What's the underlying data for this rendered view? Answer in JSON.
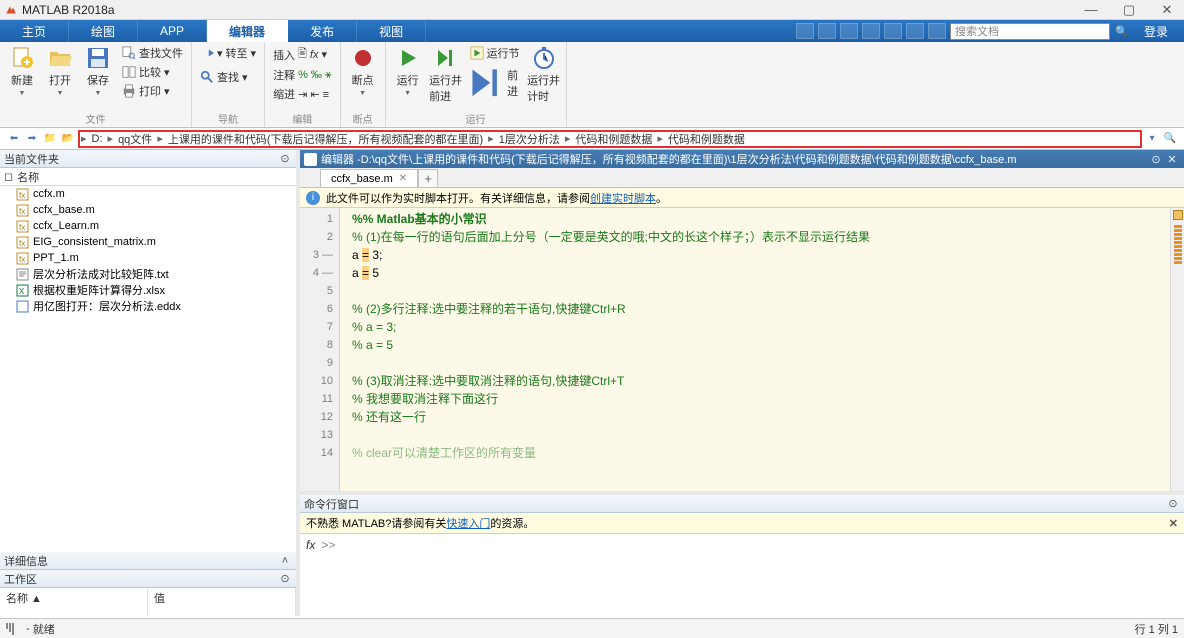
{
  "app_title": "MATLAB R2018a",
  "tabs": [
    "主页",
    "绘图",
    "APP",
    "编辑器",
    "发布",
    "视图"
  ],
  "active_tab_index": 3,
  "search_placeholder": "搜索文档",
  "login_label": "登录",
  "ribbon": {
    "groups": [
      {
        "name": "文件",
        "big": [
          {
            "key": "new",
            "label": "新建"
          },
          {
            "key": "open",
            "label": "打开"
          },
          {
            "key": "save",
            "label": "保存"
          }
        ],
        "small": [
          {
            "key": "findfiles",
            "label": "查找文件"
          },
          {
            "key": "compare",
            "label": "比较"
          },
          {
            "key": "print",
            "label": "打印"
          }
        ]
      },
      {
        "name": "导航",
        "big": [],
        "small": [
          {
            "key": "goto",
            "label": "转至"
          },
          {
            "key": "find",
            "label": "查找"
          }
        ]
      },
      {
        "name": "编辑",
        "big": [],
        "small": [
          {
            "key": "insert",
            "label": "插入"
          },
          {
            "key": "comment",
            "label": "注释"
          },
          {
            "key": "indent",
            "label": "缩进"
          }
        ]
      },
      {
        "name": "断点",
        "big": [
          {
            "key": "bp",
            "label": "断点"
          }
        ]
      },
      {
        "name": "运行",
        "big": [
          {
            "key": "run",
            "label": "运行"
          },
          {
            "key": "runadv",
            "label": "运行并\n前进"
          },
          {
            "key": "runsec",
            "label": "前进"
          },
          {
            "key": "runtime",
            "label": "运行并\n计时"
          }
        ],
        "small": [
          {
            "key": "runsection",
            "label": "运行节"
          }
        ]
      }
    ]
  },
  "path_segments": [
    "D:",
    "qq文件",
    "上课用的课件和代码(下载后记得解压，所有视频配套的都在里面)",
    "1层次分析法",
    "代码和例题数据",
    "代码和例题数据"
  ],
  "panels": {
    "current_folder": "当前文件夹",
    "name_col": "名称",
    "details": "详细信息",
    "workspace": "工作区",
    "ws_cols": [
      "名称 ▲",
      "值"
    ],
    "command_window": "命令行窗口"
  },
  "files": [
    {
      "name": "ccfx.m",
      "type": "m"
    },
    {
      "name": "ccfx_base.m",
      "type": "m"
    },
    {
      "name": "ccfx_Learn.m",
      "type": "m"
    },
    {
      "name": "EIG_consistent_matrix.m",
      "type": "m"
    },
    {
      "name": "PPT_1.m",
      "type": "m"
    },
    {
      "name": "层次分析法成对比较矩阵.txt",
      "type": "txt"
    },
    {
      "name": "根据权重矩阵计算得分.xlsx",
      "type": "xlsx"
    },
    {
      "name": "用亿图打开：层次分析法.eddx",
      "type": "eddx"
    }
  ],
  "editor": {
    "title_prefix": "编辑器 - ",
    "filepath": "D:\\qq文件\\上课用的课件和代码(下载后记得解压，所有视频配套的都在里面)\\1层次分析法\\代码和例题数据\\代码和例题数据\\ccfx_base.m",
    "tab": "ccfx_base.m",
    "info_pre": "此文件可以作为实时脚本打开。有关详细信息，请参阅 ",
    "info_link": "创建实时脚本",
    "info_post": "。",
    "lines": [
      {
        "n": "1",
        "cls": "c-sect",
        "raw": "%% Matlab基本的小常识"
      },
      {
        "n": "2",
        "cls": "c-comm",
        "raw": "% (1)在每一行的语句后面加上分号（一定要是英文的哦;中文的长这个样子；）表示不显示运行结果"
      },
      {
        "n": "3 —",
        "cls": "c-code",
        "raw": "a = 3;",
        "hl": "="
      },
      {
        "n": "4 —",
        "cls": "c-code",
        "raw": "a = 5",
        "hl": "="
      },
      {
        "n": "5",
        "cls": "",
        "raw": ""
      },
      {
        "n": "6",
        "cls": "c-comm",
        "raw": "% (2)多行注释:选中要注释的若干语句,快捷键Ctrl+R"
      },
      {
        "n": "7",
        "cls": "c-comm",
        "raw": "% a = 3;"
      },
      {
        "n": "8",
        "cls": "c-comm",
        "raw": "% a = 5"
      },
      {
        "n": "9",
        "cls": "",
        "raw": ""
      },
      {
        "n": "10",
        "cls": "c-comm",
        "raw": "% (3)取消注释:选中要取消注释的语句,快捷键Ctrl+T"
      },
      {
        "n": "11",
        "cls": "c-comm",
        "raw": "% 我想要取消注释下面这行"
      },
      {
        "n": "12",
        "cls": "c-comm",
        "raw": "% 还有这一行"
      },
      {
        "n": "13",
        "cls": "",
        "raw": ""
      },
      {
        "n": "14",
        "cls": "c-comm",
        "raw": "% clear可以清楚工作区的所有变量",
        "cut": true
      }
    ]
  },
  "command": {
    "info_pre": "不熟悉 MATLAB?请参阅有关",
    "info_link": "快速入门",
    "info_post": "的资源。",
    "prompt": ">>"
  },
  "status": {
    "ready": "就绪",
    "pos": "行 1  列 1"
  }
}
